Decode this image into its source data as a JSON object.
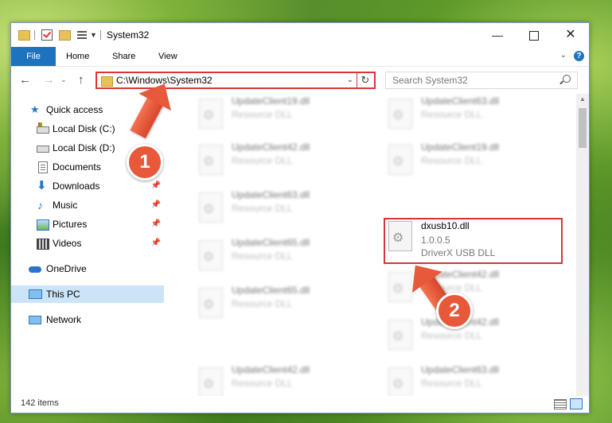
{
  "window": {
    "title": "System32",
    "min_glyph": "—",
    "close_glyph": "✕"
  },
  "ribbon": {
    "file": "File",
    "home": "Home",
    "share": "Share",
    "view": "View",
    "collapse_glyph": "⌄",
    "help_glyph": "?"
  },
  "nav": {
    "back_glyph": "←",
    "forward_glyph": "→",
    "recent_glyph": "⌄",
    "up_glyph": "↑",
    "address": "C:\\Windows\\System32",
    "address_drop_glyph": "⌄",
    "refresh_glyph": "↻",
    "search_placeholder": "Search System32"
  },
  "sidebar": {
    "items": [
      {
        "label": "Quick access",
        "icon": "star-icon"
      },
      {
        "label": "Local Disk (C:)",
        "icon": "disk-icon"
      },
      {
        "label": "Local Disk (D:)",
        "icon": "disk-icon"
      },
      {
        "label": "Documents",
        "icon": "documents-icon"
      },
      {
        "label": "Downloads",
        "icon": "downloads-icon"
      },
      {
        "label": "Music",
        "icon": "music-icon"
      },
      {
        "label": "Pictures",
        "icon": "pictures-icon"
      },
      {
        "label": "Videos",
        "icon": "videos-icon"
      },
      {
        "label": "OneDrive",
        "icon": "onedrive-icon"
      },
      {
        "label": "This PC",
        "icon": "pc-icon"
      },
      {
        "label": "Network",
        "icon": "network-icon"
      }
    ],
    "pin_glyph": "📌",
    "star_glyph": "★",
    "down_glyph": "⬇",
    "music_glyph": "♪"
  },
  "files": [
    {
      "name": "UpdateClient19.dll",
      "desc": "Resource DLL"
    },
    {
      "name": "UpdateClient63.dll",
      "desc": "Resource DLL"
    },
    {
      "name": "UpdateClient42.dll",
      "desc": "Resource DLL"
    },
    {
      "name": "UpdateClient19.dll",
      "desc": "Resource DLL"
    },
    {
      "name": "UpdateClient63.dll",
      "desc": "Resource DLL"
    },
    {
      "name": "UpdateClient65.dll",
      "desc": "Resource DLL"
    },
    {
      "name": "UpdateClient42.dll",
      "desc": "Resource DLL"
    },
    {
      "name": "UpdateClient65.dll",
      "desc": "Resource DLL"
    },
    {
      "name": "UpdateClient42.dll",
      "desc": "Resource DLL"
    },
    {
      "name": "UpdateClient42.dll",
      "desc": "Resource DLL"
    },
    {
      "name": "UpdateClient63.dll",
      "desc": "Resource DLL"
    }
  ],
  "highlighted_file": {
    "name": "dxusb10.dll",
    "version": "1.0.0.5",
    "desc": "DriverX USB DLL"
  },
  "status": {
    "item_count": "142 items"
  },
  "annotations": {
    "step1": "1",
    "step2": "2",
    "color": "#e8583a"
  },
  "scroll": {
    "up_glyph": "▲"
  }
}
